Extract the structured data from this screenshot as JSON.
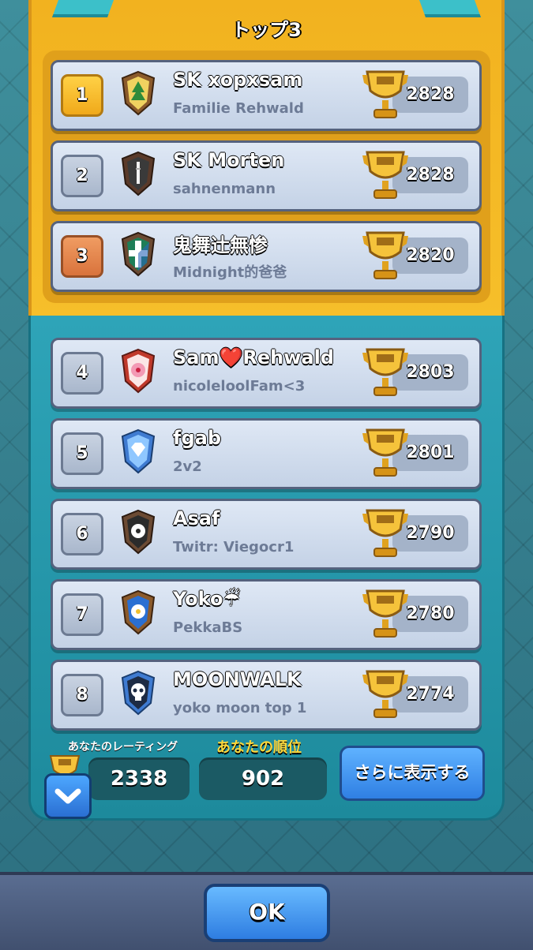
{
  "header": {
    "title": "トップ3"
  },
  "rows": [
    {
      "rank": "1",
      "name": "SK xopxsam",
      "clan": "Familie Rehwald",
      "trophies": "2828",
      "rank_style": "gold",
      "badge_icon": "tree-shield-icon"
    },
    {
      "rank": "2",
      "name": "SK Morten",
      "clan": "sahnenmann",
      "trophies": "2828",
      "rank_style": "silver",
      "badge_icon": "bamboo-shield-icon"
    },
    {
      "rank": "3",
      "name": "鬼舞辻無惨",
      "clan": "Midnight的爸爸",
      "trophies": "2820",
      "rank_style": "bronze",
      "badge_icon": "cross-shield-icon"
    },
    {
      "rank": "4",
      "name": "Sam❤️Rehwald",
      "clan": "nicoleloolFam<3",
      "trophies": "2803",
      "rank_style": "plain",
      "badge_icon": "blossom-shield-icon"
    },
    {
      "rank": "5",
      "name": "fgab",
      "clan": "2v2",
      "trophies": "2801",
      "rank_style": "plain",
      "badge_icon": "diamond-shield-icon"
    },
    {
      "rank": "6",
      "name": "Asaf",
      "clan": "Twitr: Viegocr1",
      "trophies": "2790",
      "rank_style": "plain",
      "badge_icon": "flower-shield-icon"
    },
    {
      "rank": "7",
      "name": "Yoko☔",
      "clan": "PekkaBS",
      "trophies": "2780",
      "rank_style": "plain",
      "badge_icon": "daisy-shield-icon"
    },
    {
      "rank": "8",
      "name": "MOONWALK",
      "clan": "yoko moon top 1",
      "trophies": "2774",
      "rank_style": "plain",
      "badge_icon": "skull-shield-icon"
    }
  ],
  "footer_stats": {
    "rating_label": "あなたのレーティング",
    "rating_value": "2338",
    "rank_label": "あなたの順位",
    "rank_value": "902",
    "more_button": "さらに表示する"
  },
  "ok_button": "OK",
  "colors": {
    "gold_frame": "#f2b21f",
    "teal_frame": "#2ea4b8",
    "button_blue": "#2f7fe3"
  }
}
